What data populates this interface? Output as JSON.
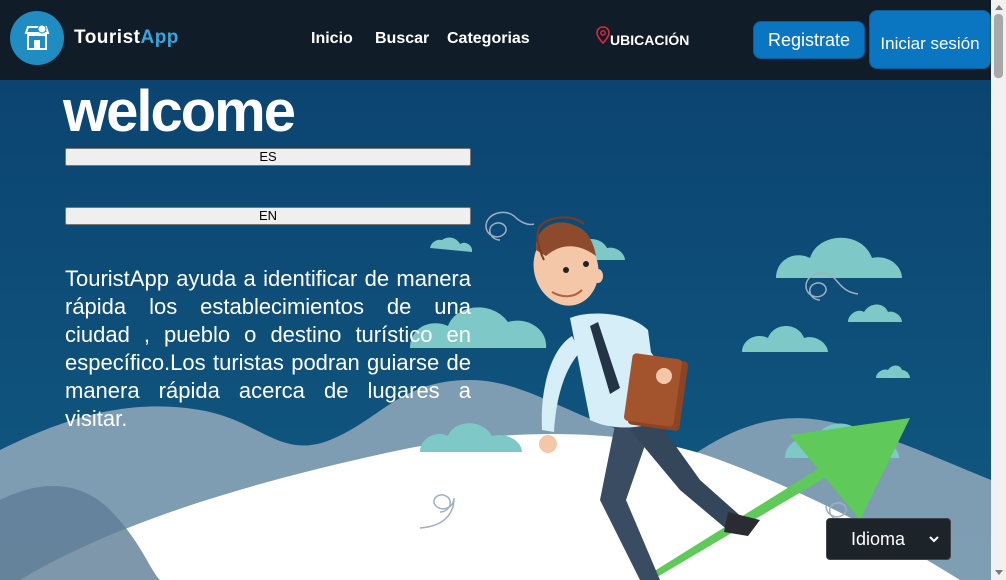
{
  "brand": {
    "name_main": "Tourist",
    "name_accent": "App"
  },
  "nav": {
    "links": [
      "Inicio",
      "Buscar",
      "Categorias"
    ],
    "location_label": "UBICACIÓN",
    "register_label": "Registrate",
    "login_label": "Iniciar sesión"
  },
  "hero": {
    "welcome": "welcome",
    "lang_es": "ES",
    "lang_en": "EN",
    "description": "TouristApp ayuda a identificar de manera rápida los establecimientos de una ciudad , pueblo o destino turístico en específico.Los turistas podran guiarse de manera rápida acerca de lugares a visitar.",
    "language_select": "Idioma"
  },
  "colors": {
    "navbar": "#101c27",
    "accent": "#37a5df",
    "button": "#0a76c2",
    "hero_bg": "#0c4a6e",
    "cloud": "#7ec8c8",
    "arrow": "#5fc95a"
  },
  "icons": [
    "store-logo-icon",
    "location-pin-icon",
    "chevron-down-icon"
  ]
}
